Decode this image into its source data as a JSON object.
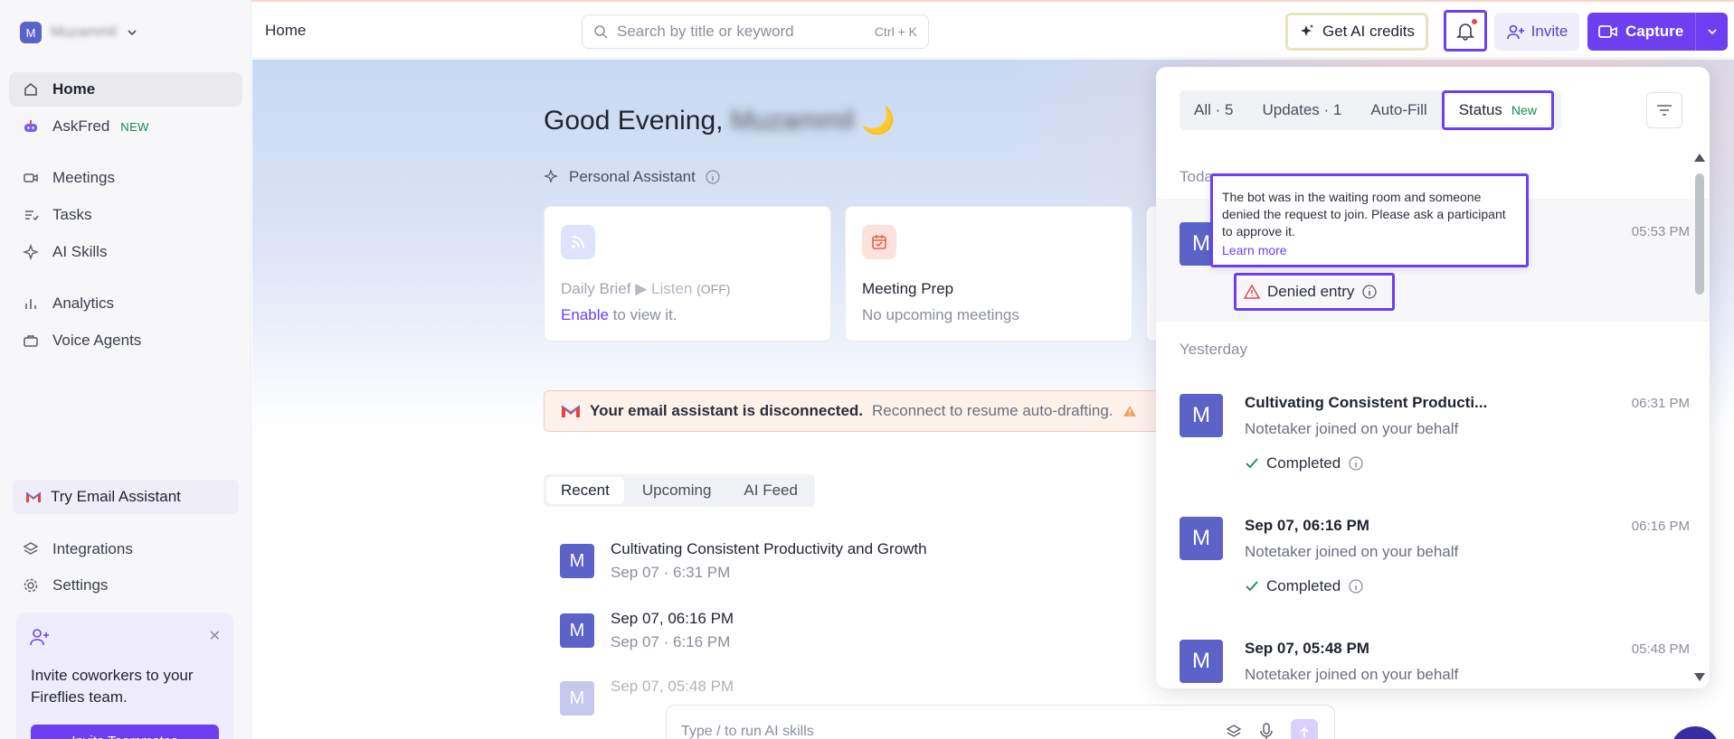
{
  "sidebar": {
    "workspace": {
      "initial": "M",
      "name": "Muzammil"
    },
    "items": [
      {
        "label": "Home"
      },
      {
        "label": "AskFred",
        "badge": "NEW"
      },
      {
        "label": "Meetings"
      },
      {
        "label": "Tasks"
      },
      {
        "label": "AI Skills"
      },
      {
        "label": "Analytics"
      },
      {
        "label": "Voice Agents"
      }
    ],
    "try_email": "Try Email Assistant",
    "integrations": "Integrations",
    "settings": "Settings",
    "invite_card": {
      "text": "Invite coworkers to your Fireflies team.",
      "button": "Invite Teammates"
    }
  },
  "topbar": {
    "breadcrumb": "Home",
    "search_placeholder": "Search by title or keyword",
    "search_shortcut": "Ctrl + K",
    "credits": "Get AI credits",
    "invite": "Invite",
    "capture": "Capture"
  },
  "main": {
    "greeting": "Good Evening,",
    "user_name": "Muzammil",
    "emoji": "🌙",
    "personal_assistant": "Personal Assistant",
    "cards": [
      {
        "title": "Daily Brief",
        "listen": "Listen",
        "off": "(OFF)",
        "link": "Enable",
        "rest": "to view it."
      },
      {
        "title": "Meeting Prep",
        "sub": "No upcoming meetings"
      }
    ],
    "email_alert": {
      "bold": "Your email assistant is disconnected.",
      "normal": "Reconnect to resume auto-drafting."
    },
    "tabs": [
      "Recent",
      "Upcoming",
      "AI Feed"
    ],
    "recent": [
      {
        "title": "Cultivating Consistent Productivity and Growth",
        "sub": "Sep 07 · 6:31 PM"
      },
      {
        "title": "Sep 07, 06:16 PM",
        "sub": "Sep 07 · 6:16 PM"
      },
      {
        "title": "Sep 07, 05:48 PM",
        "sub": ""
      }
    ],
    "chat_placeholder": "Type / to run AI skills"
  },
  "panel": {
    "tabs": [
      {
        "label": "All · 5"
      },
      {
        "label": "Updates · 1"
      },
      {
        "label": "Auto-Fill"
      },
      {
        "label": "Status",
        "badge": "New"
      }
    ],
    "today": "Today",
    "yesterday": "Yesterday",
    "tooltip": {
      "text": "The bot was in the waiting room and someone denied the request to join. Please ask a participant to approve it.",
      "link": "Learn more"
    },
    "items": [
      {
        "initial": "M",
        "time": "05:53 PM",
        "status": "Denied entry"
      },
      {
        "initial": "M",
        "title": "Cultivating Consistent Producti...",
        "sub": "Notetaker joined on your behalf",
        "time": "06:31 PM",
        "status": "Completed"
      },
      {
        "initial": "M",
        "title": "Sep 07, 06:16 PM",
        "sub": "Notetaker joined on your behalf",
        "time": "06:16 PM",
        "status": "Completed"
      },
      {
        "initial": "M",
        "title": "Sep 07, 05:48 PM",
        "sub": "Notetaker joined on your behalf",
        "time": "05:48 PM"
      }
    ]
  },
  "colors": {
    "accent": "#6d3ff0",
    "avatar": "#5b63c9",
    "success": "#17894f",
    "danger": "#e5484d",
    "warning": "#f0a35a"
  }
}
